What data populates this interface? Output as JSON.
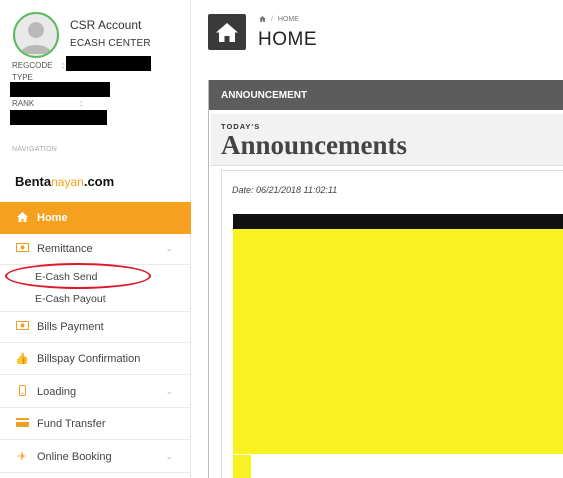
{
  "account": {
    "name": "CSR Account",
    "center": "ECASH CENTER",
    "regcode_label": "REGCODE",
    "type_label": "TYPE",
    "rank_label": "RANK",
    "separator": ":"
  },
  "sidebar": {
    "nav_label": "NAVIGATION",
    "brand_main": "Benta",
    "brand_accent": "nayan",
    "brand_suffix": ".com",
    "items": [
      {
        "label": "Home",
        "icon": "home-icon"
      },
      {
        "label": "Remittance",
        "icon": "money-icon"
      },
      {
        "label": "Bills Payment",
        "icon": "money-icon"
      },
      {
        "label": "Billspay Confirmation",
        "icon": "thumbs-up-icon"
      },
      {
        "label": "Loading",
        "icon": "mobile-icon"
      },
      {
        "label": "Fund Transfer",
        "icon": "credit-card-icon"
      },
      {
        "label": "Online Booking",
        "icon": "plane-icon"
      }
    ],
    "remittance_sub": [
      {
        "label": "E-Cash Send"
      },
      {
        "label": "E-Cash Payout"
      }
    ]
  },
  "header": {
    "breadcrumb": "HOME",
    "title": "HOME"
  },
  "panel": {
    "header": "ANNOUNCEMENT",
    "todays": "TODAY'S",
    "title": "Announcements",
    "date": "Date:  06/21/2018 11:02:11"
  },
  "colors": {
    "accent": "#f5a01e",
    "highlight": "#e0182a",
    "panel_header": "#5c5c5c",
    "announcement_image": "#f9f223"
  }
}
